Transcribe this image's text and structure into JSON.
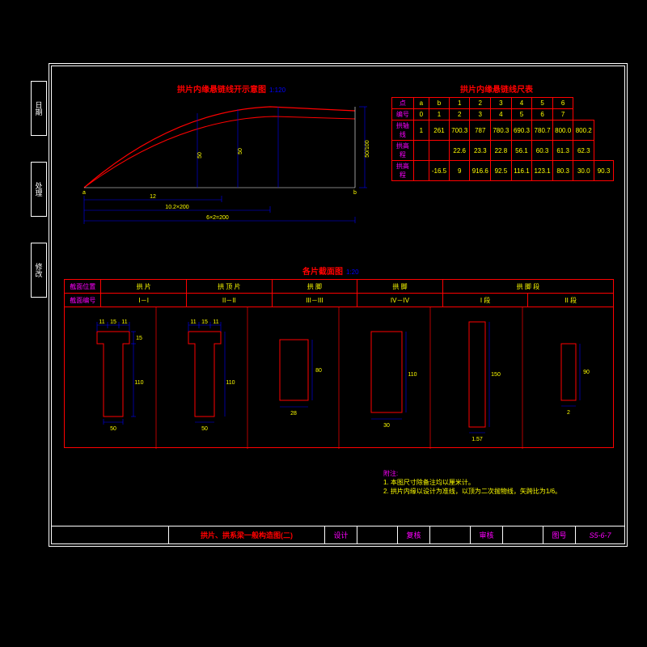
{
  "tabs": {
    "t1": "日期",
    "t2": "处理",
    "t3": "修改"
  },
  "titles": {
    "arch": "拱片内缘悬链线开示意图",
    "arch_scale": "1:120",
    "table": "拱片内缘悬链线尺表",
    "sections": "各片截面图",
    "sections_scale": "1:20"
  },
  "dim_table": {
    "rows": [
      [
        "点",
        "a",
        "b",
        "1",
        "2",
        "3",
        "4",
        "5",
        "6"
      ],
      [
        "编号",
        "0",
        "1",
        "2",
        "3",
        "4",
        "5",
        "6",
        "7"
      ],
      [
        "拱轴线",
        "1",
        "261",
        "700.3",
        "787",
        "780.3",
        "690.3",
        "780.7",
        "800.0",
        "800.2"
      ],
      [
        "拱高程",
        "",
        "",
        "22.6",
        "23.3",
        "22.8",
        "56.1",
        "60.3",
        "61.3",
        "62.3"
      ],
      [
        "拱高程",
        "",
        "-16.5",
        "9",
        "916.6",
        "92.5",
        "116.1",
        "123.1",
        "80.3",
        "30.0",
        "90.3"
      ]
    ]
  },
  "sec_headers": {
    "row1": [
      "截面位置",
      "拱 片",
      "拱 顶 片",
      "拱 脚",
      "拱 脚",
      "拱 脚 段"
    ],
    "row2": [
      "截面编号",
      "I－I",
      "II－II",
      "III－III",
      "IV－IV",
      "I 段",
      "II 段"
    ]
  },
  "sec_dims": {
    "s1": {
      "top": [
        "11",
        "15",
        "11"
      ],
      "side": [
        "15",
        "110"
      ],
      "bottom": "50"
    },
    "s2": {
      "top": [
        "11",
        "15",
        "11"
      ],
      "side": [
        "15",
        "110"
      ],
      "bottom": "50"
    },
    "s3": {
      "bottom": "28",
      "side": "80"
    },
    "s4": {
      "bottom": "30",
      "side": "110"
    },
    "s5": {
      "bottom": "1.57",
      "side": "150"
    },
    "s6": {
      "bottom": "2",
      "side": "90"
    }
  },
  "arch_dims": {
    "d1": "12",
    "d2": "10.2×200",
    "d3": "6×2=200",
    "v1": "50",
    "v2": "50",
    "v3": "50/100"
  },
  "notes": {
    "h": "附注:",
    "l1": "1. 本图尺寸除备注均以厘米计。",
    "l2": "2. 拱片内缘以设计为准线，以顶为二次抛物线，矢跨比为1/6。"
  },
  "titleblock": {
    "title": "拱片、拱系梁一般构造图(二)",
    "c1": "设计",
    "c2": "复核",
    "c3": "审核",
    "c4": "图号",
    "num": "S5-6-7"
  },
  "chart_data": {
    "type": "line",
    "title": "拱片内缘悬链线开示意图",
    "xlabel": "",
    "ylabel": "",
    "x": [
      0,
      1,
      2,
      3,
      4,
      5,
      6,
      7
    ],
    "series": [
      {
        "name": "拱轴线",
        "values": [
          0,
          261,
          700.3,
          787,
          780.3,
          690.3,
          780.7,
          800.0
        ]
      },
      {
        "name": "拱高程",
        "values": [
          0,
          22.6,
          23.3,
          22.8,
          56.1,
          60.3,
          61.3,
          62.3
        ]
      }
    ]
  }
}
